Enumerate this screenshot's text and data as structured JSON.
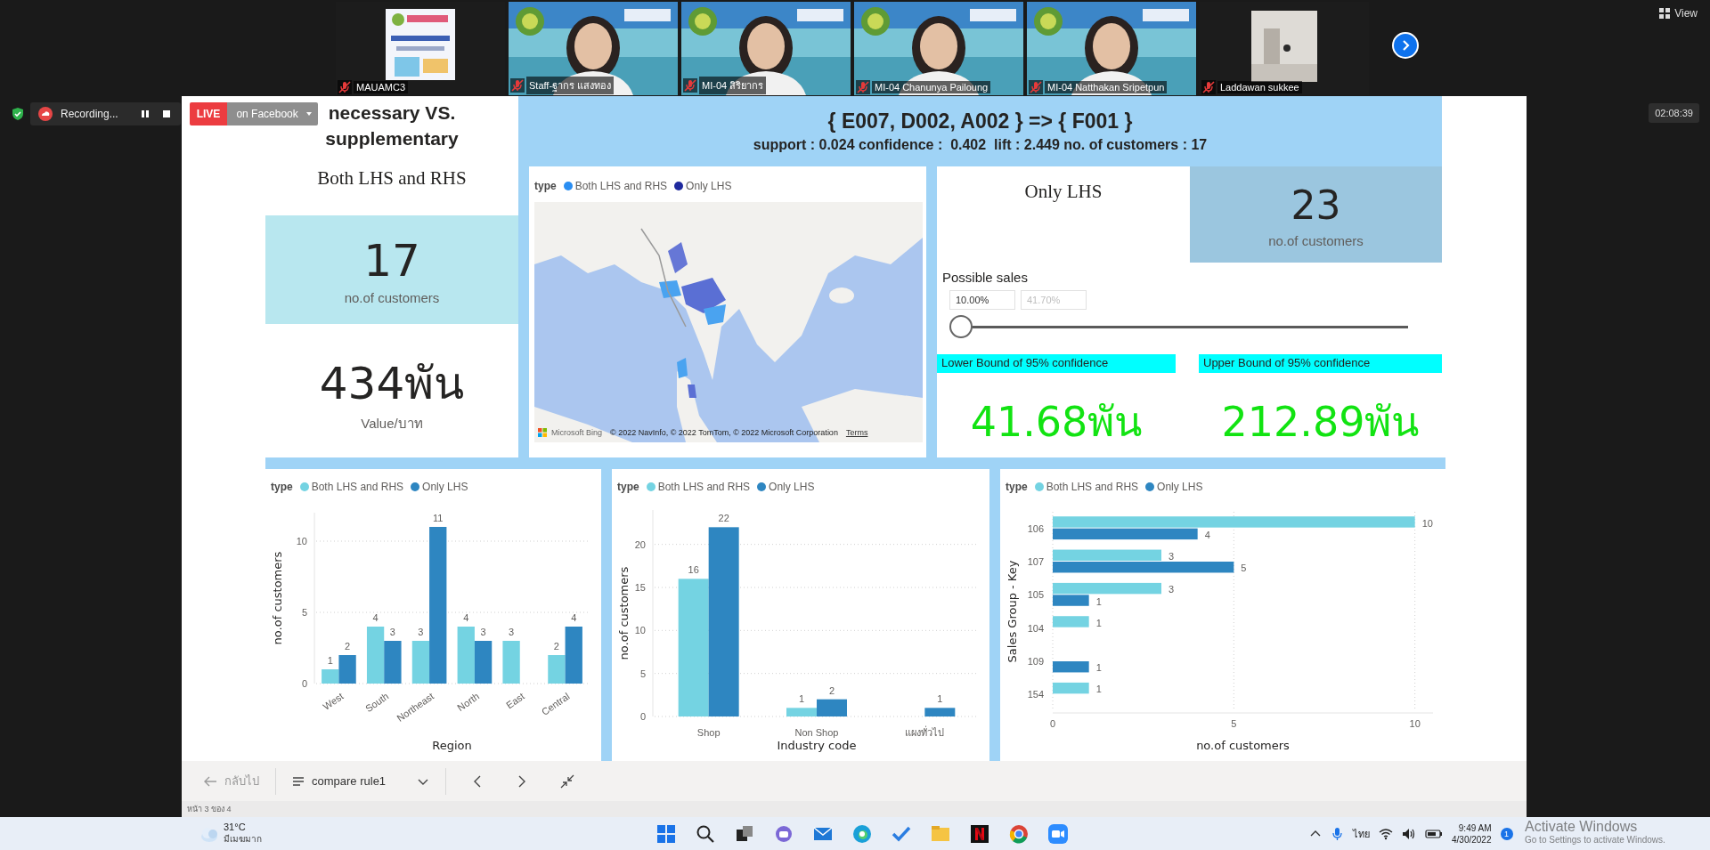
{
  "meeting": {
    "participants": [
      {
        "name": "MAUAMC3",
        "muted": true,
        "kind": "poster"
      },
      {
        "name": "Staff-ฐากร แสงทอง",
        "muted": true,
        "kind": "person"
      },
      {
        "name": "MI-04 สิริยากร",
        "muted": true,
        "kind": "person"
      },
      {
        "name": "MI-04 Chanunya Pailoung",
        "muted": true,
        "kind": "person"
      },
      {
        "name": "MI-04 Natthakan Sripetpun",
        "muted": true,
        "kind": "person"
      },
      {
        "name": "Laddawan sukkee",
        "muted": true,
        "kind": "room"
      }
    ],
    "view_button": "View",
    "timer": "02:08:39",
    "recording": "Recording...",
    "live": {
      "badge": "LIVE",
      "label": "on Facebook"
    }
  },
  "report": {
    "title": "necessary VS. supplementary",
    "rule": "{ E007, D002, A002 } => { F001 }",
    "metrics": "support : 0.024 confidence :  0.402  lift : 2.449 no. of customers : 17",
    "both_panel": {
      "heading": "Both LHS and RHS",
      "count": "17",
      "count_label": "no.of customers",
      "value": "434พัน",
      "value_label": "Value/บาท"
    },
    "map": {
      "legend_title": "type",
      "legend": [
        {
          "label": "Both LHS and RHS",
          "color": "#2a8ef2"
        },
        {
          "label": "Only LHS",
          "color": "#1f2a9e"
        }
      ],
      "brand": "Microsoft Bing",
      "attribution": "© 2022 NavInfo, © 2022 TomTom, © 2022 Microsoft Corporation",
      "terms": "Terms"
    },
    "only_panel": {
      "heading": "Only LHS",
      "count": "23",
      "count_label": "no.of customers",
      "slider": {
        "label": "Possible sales",
        "from": "10.00%",
        "to_placeholder": "41.70%",
        "level": 0
      },
      "lower": {
        "label": "Lower Bound of 95% confidence",
        "value": "41.68พัน"
      },
      "upper": {
        "label": "Upper Bound of 95% confidence",
        "value": "212.89พัน"
      }
    },
    "charts": [
      {
        "legend_title": "type",
        "chart_data": {
          "type": "bar",
          "xlabel": "Region",
          "ylabel": "no.of customers",
          "categories": [
            "West",
            "South",
            "Northeast",
            "North",
            "East",
            "Central"
          ],
          "series": [
            {
              "name": "Both LHS and RHS",
              "color": "#74d3e2",
              "values": [
                1,
                4,
                3,
                4,
                3,
                2
              ]
            },
            {
              "name": "Only LHS",
              "color": "#2e86c1",
              "values": [
                2,
                3,
                11,
                3,
                null,
                4
              ]
            }
          ],
          "ylim": [
            0,
            12
          ],
          "yticks": [
            0,
            5,
            10
          ],
          "grid": true,
          "data_labels": true
        }
      },
      {
        "legend_title": "type",
        "chart_data": {
          "type": "bar",
          "xlabel": "Industry code",
          "ylabel": "no.of customers",
          "categories": [
            "Shop",
            "Non Shop",
            "แผงทั่วไป"
          ],
          "series": [
            {
              "name": "Both LHS and RHS",
              "color": "#74d3e2",
              "values": [
                16,
                1,
                null
              ]
            },
            {
              "name": "Only LHS",
              "color": "#2e86c1",
              "values": [
                22,
                2,
                1
              ]
            }
          ],
          "ylim": [
            0,
            24
          ],
          "yticks": [
            0,
            5,
            10,
            15,
            20
          ],
          "grid": true,
          "data_labels": true
        }
      },
      {
        "legend_title": "type",
        "chart_data": {
          "type": "bar",
          "orientation": "horizontal",
          "xlabel": "no.of customers",
          "ylabel": "Sales Group - Key",
          "categories": [
            "106",
            "107",
            "105",
            "104",
            "109",
            "154"
          ],
          "series": [
            {
              "name": "Both LHS and RHS",
              "color": "#74d3e2",
              "values": [
                10,
                3,
                3,
                1,
                null,
                1
              ]
            },
            {
              "name": "Only LHS",
              "color": "#2e86c1",
              "values": [
                4,
                5,
                1,
                null,
                1,
                null
              ]
            }
          ],
          "xlim": [
            0,
            10.5
          ],
          "xticks": [
            0,
            5,
            10
          ],
          "grid": true,
          "data_labels": true
        }
      }
    ]
  },
  "nav": {
    "back": "กลับไป",
    "page_select": "compare rule1",
    "page_indicator": "หน้า 3 ของ 4"
  },
  "taskbar": {
    "temperature": "31°C",
    "condition": "มีเมฆมาก",
    "language": "ไทย",
    "time": "9:49 AM",
    "date": "4/30/2022",
    "notifications": "1"
  },
  "system_notice": {
    "title": "Activate Windows",
    "text": "Go to Settings to activate Windows."
  }
}
